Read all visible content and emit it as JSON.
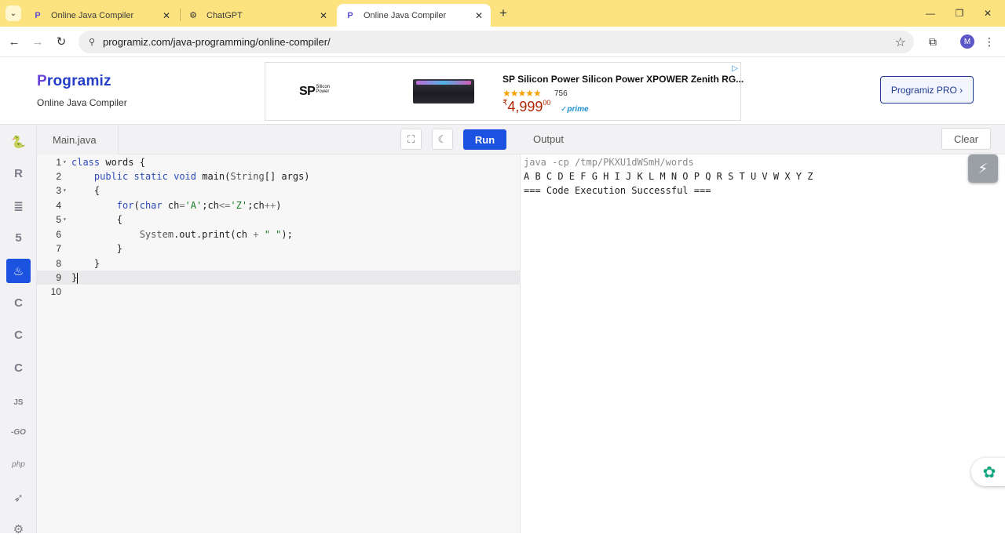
{
  "browser": {
    "tabs": [
      {
        "title": "Online Java Compiler",
        "icon": "programiz-icon",
        "active": false
      },
      {
        "title": "ChatGPT",
        "icon": "chatgpt-icon",
        "active": false
      },
      {
        "title": "Online Java Compiler",
        "icon": "programiz-icon",
        "active": true
      }
    ],
    "url": "programiz.com/java-programming/online-compiler/",
    "profile_initial": "M",
    "theme_color": "#fce380"
  },
  "header": {
    "logo_first_letter": "P",
    "logo_rest": "rogramiz",
    "subtitle": "Online Java Compiler",
    "pro_button": "Programiz PRO ›"
  },
  "ad": {
    "brand": "SP",
    "brand_small_1": "Silicon",
    "brand_small_2": "Power",
    "title": "SP Silicon Power Silicon Power XPOWER Zenith RG...",
    "stars": "★★★★★",
    "rating_count": "756",
    "currency": "₹",
    "price": "4,999",
    "price_fraction": "00",
    "prime": "✓prime"
  },
  "sidebar": {
    "languages": [
      {
        "name": "python",
        "glyph": "🐍"
      },
      {
        "name": "r",
        "glyph": "R"
      },
      {
        "name": "sql",
        "glyph": "≣"
      },
      {
        "name": "html",
        "glyph": "5"
      },
      {
        "name": "java",
        "glyph": "♨"
      },
      {
        "name": "c",
        "glyph": "C"
      },
      {
        "name": "cpp",
        "glyph": "C"
      },
      {
        "name": "csharp",
        "glyph": "C"
      },
      {
        "name": "javascript",
        "glyph": "JS"
      },
      {
        "name": "go",
        "glyph": "-GO"
      },
      {
        "name": "php",
        "glyph": "php"
      },
      {
        "name": "swift",
        "glyph": "➶"
      },
      {
        "name": "rust",
        "glyph": "⚙"
      }
    ],
    "active": "java"
  },
  "editor": {
    "file_name": "Main.java",
    "run_label": "Run",
    "lines": [
      "class words {",
      "    public static void main(String[] args)",
      "    {",
      "        for(char ch='A';ch<='Z';ch++)",
      "        {",
      "            System.out.print(ch + \" \");",
      "        }",
      "    }",
      "}",
      ""
    ],
    "line_numbers": [
      "1",
      "2",
      "3",
      "4",
      "5",
      "6",
      "7",
      "8",
      "9",
      "10"
    ]
  },
  "output": {
    "label": "Output",
    "clear_label": "Clear",
    "lines": [
      "java -cp /tmp/PKXU1dWSmH/words",
      "A B C D E F G H I J K L M N O P Q R S T U V W X Y Z",
      "=== Code Execution Successful ==="
    ]
  },
  "colors": {
    "accent": "#1b52e0",
    "logo": "#253ec7"
  }
}
